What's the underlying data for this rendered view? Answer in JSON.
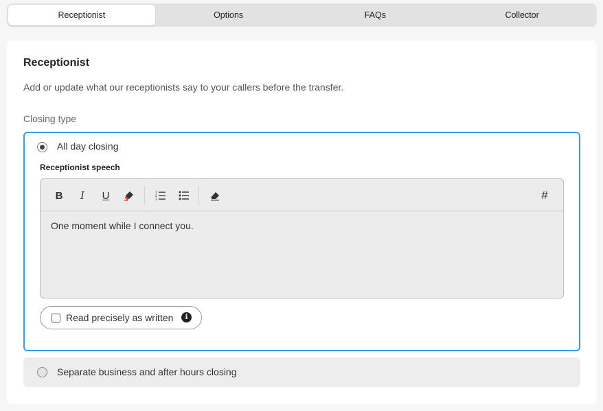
{
  "tabs": [
    {
      "label": "Receptionist",
      "active": true
    },
    {
      "label": "Options",
      "active": false
    },
    {
      "label": "FAQs",
      "active": false
    },
    {
      "label": "Collector",
      "active": false
    }
  ],
  "card": {
    "title": "Receptionist",
    "description": "Add or update what our receptionists say to your callers before the transfer.",
    "closing_type_label": "Closing type"
  },
  "options": {
    "all_day": {
      "label": "All day closing",
      "selected": true,
      "speech_label": "Receptionist speech",
      "speech_text": "One moment while I connect you.",
      "read_precisely_label": "Read precisely as written",
      "read_precisely_checked": false
    },
    "separate": {
      "label": "Separate business and after hours closing",
      "selected": false
    }
  },
  "toolbar": {
    "bold": "B",
    "italic": "I",
    "underline": "U",
    "hash": "#",
    "info": "i"
  },
  "colors": {
    "accent": "#3b9ae6",
    "highlight_red": "#d62b2b"
  }
}
